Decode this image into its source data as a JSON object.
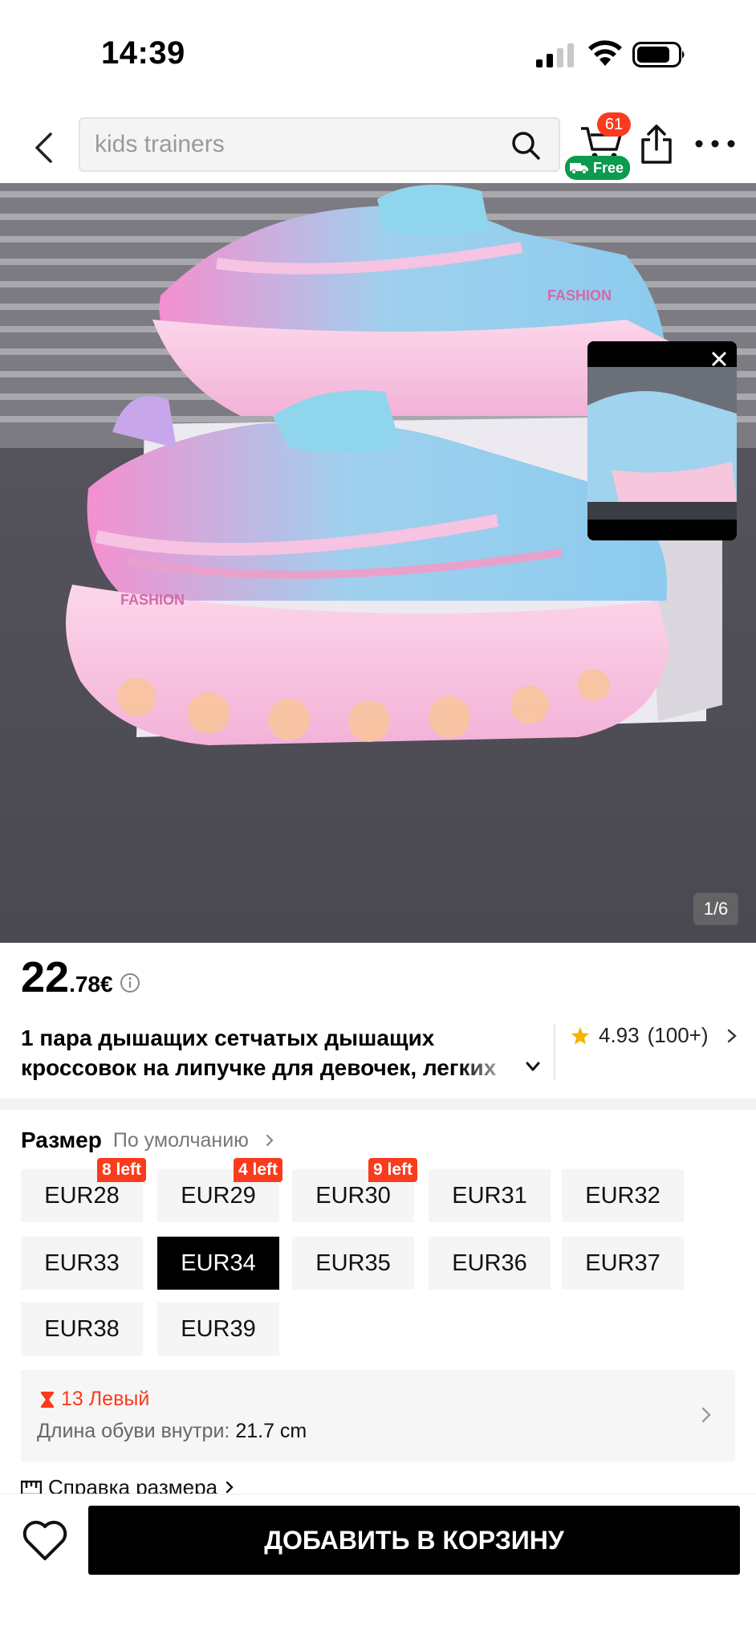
{
  "status_bar": {
    "time": "14:39"
  },
  "header": {
    "search_placeholder": "kids trainers",
    "cart_count": "61",
    "free_badge": "Free"
  },
  "product": {
    "image_counter": "1/6",
    "image_labels": [
      "FASHION",
      "FASHION"
    ],
    "price_integer": "22",
    "price_fraction": ".78",
    "price_currency": "€",
    "title_line1": "1 пара дышащих сетчатых дышащих",
    "title_line2": "кроссовок на липучке для девочек, легких",
    "rating": "4.93",
    "rating_count": "(100+)"
  },
  "size_section": {
    "label": "Размер",
    "sort_label": "По умолчанию",
    "sizes": [
      {
        "label": "EUR28",
        "badge": "8 left"
      },
      {
        "label": "EUR29",
        "badge": "4 left"
      },
      {
        "label": "EUR30",
        "badge": "9 left"
      },
      {
        "label": "EUR31",
        "badge": ""
      },
      {
        "label": "EUR32",
        "badge": ""
      },
      {
        "label": "EUR33",
        "badge": ""
      },
      {
        "label": "EUR34",
        "badge": "",
        "selected": true
      },
      {
        "label": "EUR35",
        "badge": ""
      },
      {
        "label": "EUR36",
        "badge": ""
      },
      {
        "label": "EUR37",
        "badge": ""
      },
      {
        "label": "EUR38",
        "badge": ""
      },
      {
        "label": "EUR39",
        "badge": ""
      }
    ],
    "stock_text": "13 Левый",
    "foot_length_label": "Длина обуви внутри:",
    "foot_length_value": "21.7 cm",
    "size_chart_label": "Справка размера"
  },
  "bottom_bar": {
    "add_to_cart": "ДОБАВИТЬ В КОРЗИНУ"
  },
  "colors": {
    "accent_red": "#fa3b1d",
    "free_green": "#0a9b4e",
    "primary_black": "#000000"
  }
}
